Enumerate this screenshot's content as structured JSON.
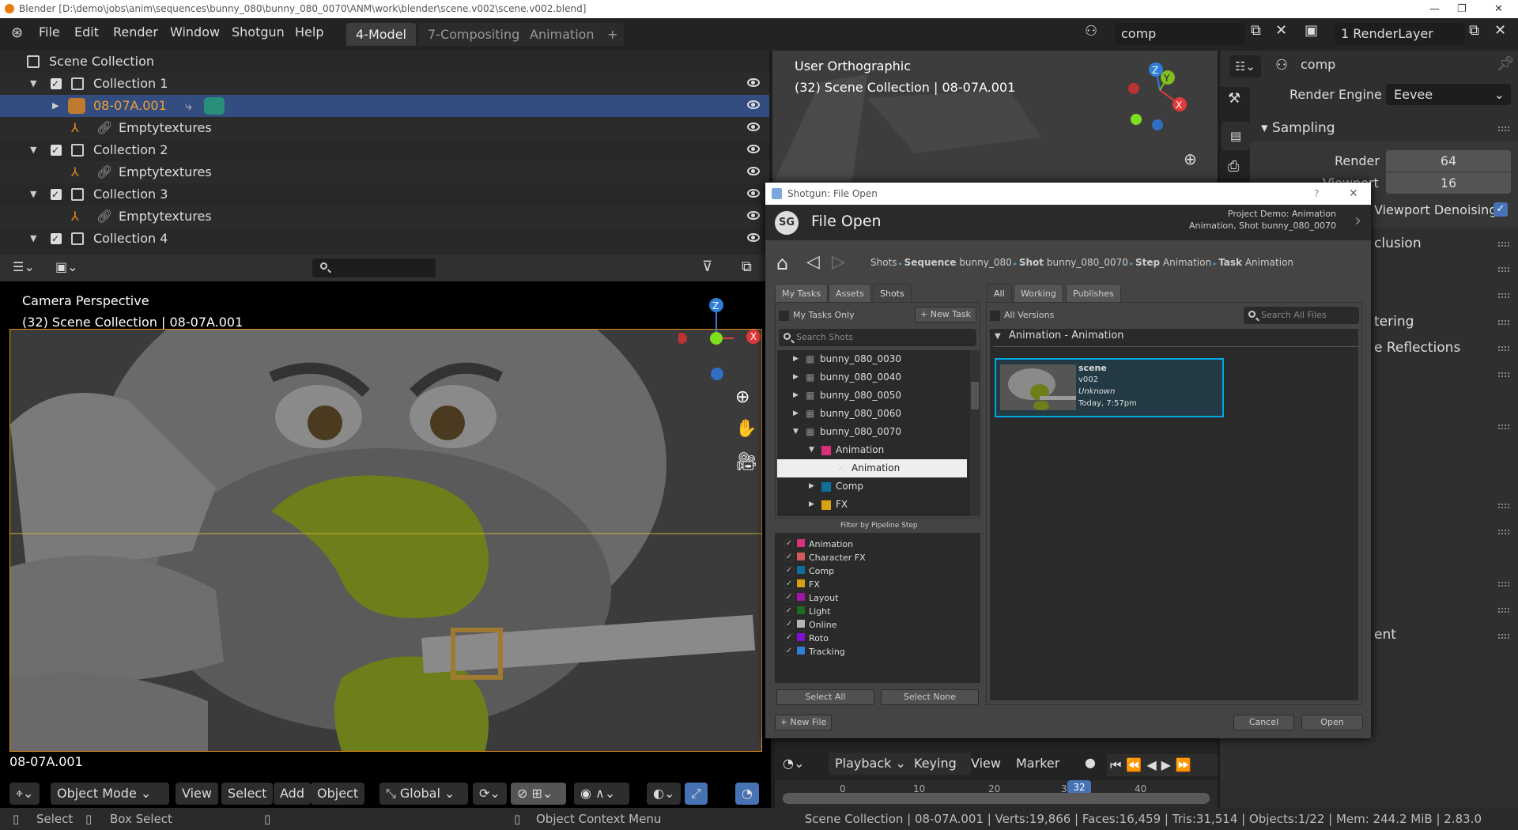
{
  "window_title": "Blender [D:\\demo\\jobs\\anim\\sequences\\bunny_080\\bunny_080_0070\\ANM\\work\\blender\\scene.v002\\scene.v002.blend]",
  "menu": [
    "File",
    "Edit",
    "Render",
    "Window",
    "Shotgun",
    "Help"
  ],
  "workspaces": [
    {
      "label": "4-Model",
      "active": true
    },
    {
      "label": "7-Compositing"
    },
    {
      "label": "Animation"
    },
    {
      "label": "+"
    }
  ],
  "scene_field": "comp",
  "view_layer_field": "1 RenderLayer",
  "outliner": {
    "root": "Scene Collection",
    "rows": [
      {
        "label": "Collection 1",
        "type": "collection"
      },
      {
        "label": "08-07A.001",
        "type": "object",
        "selected": true
      },
      {
        "label": "Emptytextures",
        "type": "child"
      },
      {
        "label": "Collection 2",
        "type": "collection"
      },
      {
        "label": "Emptytextures",
        "type": "child"
      },
      {
        "label": "Collection 3",
        "type": "collection"
      },
      {
        "label": "Emptytextures",
        "type": "child"
      },
      {
        "label": "Collection 4",
        "type": "collection"
      }
    ]
  },
  "viewport_top": {
    "title": "User Orthographic",
    "subtitle": "(32) Scene Collection | 08-07A.001"
  },
  "viewport_cam": {
    "title": "Camera Perspective",
    "subtitle": "(32) Scene Collection | 08-07A.001",
    "object_label": "08-07A.001",
    "toolbar": {
      "mode": "Object Mode",
      "view": "View",
      "select": "Select",
      "add": "Add",
      "object": "Object",
      "orientation": "Global"
    }
  },
  "properties": {
    "scene": "comp",
    "render_engine_label": "Render Engine",
    "render_engine": "Eevee",
    "sampling": "Sampling",
    "render_label": "Render",
    "render_value": "64",
    "viewport_label": "Viewport",
    "viewport_value": "16",
    "denoise_label": "Viewport Denoising",
    "denoise_checked": true,
    "partial": [
      "clusion",
      "tering",
      "e Reflections",
      "ent"
    ]
  },
  "timeline": {
    "menu": [
      "Playback",
      "Keying",
      "View",
      "Marker"
    ],
    "ticks": [
      "0",
      "10",
      "20",
      "30",
      "40"
    ],
    "current_frame": "32"
  },
  "statusbar": {
    "select": "Select",
    "box_select": "Box Select",
    "context_menu": "Object Context Menu",
    "stats": "Scene Collection | 08-07A.001 | Verts:19,866 | Faces:16,459 | Tris:31,514 | Objects:1/22 | Mem: 244.2 MiB | 2.83.0"
  },
  "dialog": {
    "window_title": "Shotgun: File Open",
    "help": "?",
    "logo": "SG",
    "title": "File Open",
    "context_line1": "Project Demo: Animation",
    "context_line2": "Animation, Shot bunny_080_0070",
    "breadcrumb": [
      {
        "bold": "",
        "text": "Shots"
      },
      {
        "bold": "Sequence",
        "text": " bunny_080"
      },
      {
        "bold": "Shot",
        "text": " bunny_080_0070"
      },
      {
        "bold": "Step",
        "text": " Animation"
      },
      {
        "bold": "Task",
        "text": " Animation"
      }
    ],
    "left_tabs": [
      {
        "label": "My Tasks"
      },
      {
        "label": "Assets"
      },
      {
        "label": "Shots",
        "active": true
      }
    ],
    "my_tasks_only": "My Tasks Only",
    "new_task": "+ New Task",
    "search_shots": "Search Shots",
    "tree": [
      {
        "label": "bunny_080_0030",
        "level": 0,
        "expanded": false,
        "kind": "shot"
      },
      {
        "label": "bunny_080_0040",
        "level": 0,
        "expanded": false,
        "kind": "shot"
      },
      {
        "label": "bunny_080_0050",
        "level": 0,
        "expanded": false,
        "kind": "shot"
      },
      {
        "label": "bunny_080_0060",
        "level": 0,
        "expanded": false,
        "kind": "shot"
      },
      {
        "label": "bunny_080_0070",
        "level": 0,
        "expanded": true,
        "kind": "shot"
      },
      {
        "label": "Animation",
        "level": 1,
        "expanded": true,
        "kind": "step",
        "color": "#d6317a"
      },
      {
        "label": "Animation",
        "level": 2,
        "kind": "task",
        "selected": true
      },
      {
        "label": "Comp",
        "level": 1,
        "expanded": false,
        "kind": "step",
        "color": "#0f6f9a"
      },
      {
        "label": "FX",
        "level": 1,
        "expanded": false,
        "kind": "step",
        "color": "#d9a00f"
      }
    ],
    "filter_title": "Filter by Pipeline Step",
    "filters": [
      {
        "label": "Animation",
        "color": "#d6317a"
      },
      {
        "label": "Character FX",
        "color": "#d65a5a"
      },
      {
        "label": "Comp",
        "color": "#0f6f9a"
      },
      {
        "label": "FX",
        "color": "#d9a00f"
      },
      {
        "label": "Layout",
        "color": "#a316a3"
      },
      {
        "label": "Light",
        "color": "#1f6b21"
      },
      {
        "label": "Online",
        "color": "#b5b5b5"
      },
      {
        "label": "Roto",
        "color": "#7f10d6"
      },
      {
        "label": "Tracking",
        "color": "#2f7fd6"
      }
    ],
    "select_all": "Select All",
    "select_none": "Select None",
    "new_file": "+ New File",
    "right_tabs": [
      {
        "label": "All",
        "active": true
      },
      {
        "label": "Working"
      },
      {
        "label": "Publishes"
      }
    ],
    "all_versions": "All Versions",
    "search_files": "Search All Files",
    "group": "Animation - Animation",
    "file": {
      "name": "scene",
      "version": "v002",
      "user": "Unknown",
      "date": "Today, 7:57pm"
    },
    "cancel": "Cancel",
    "open": "Open",
    "accent": "#00a8e0"
  }
}
